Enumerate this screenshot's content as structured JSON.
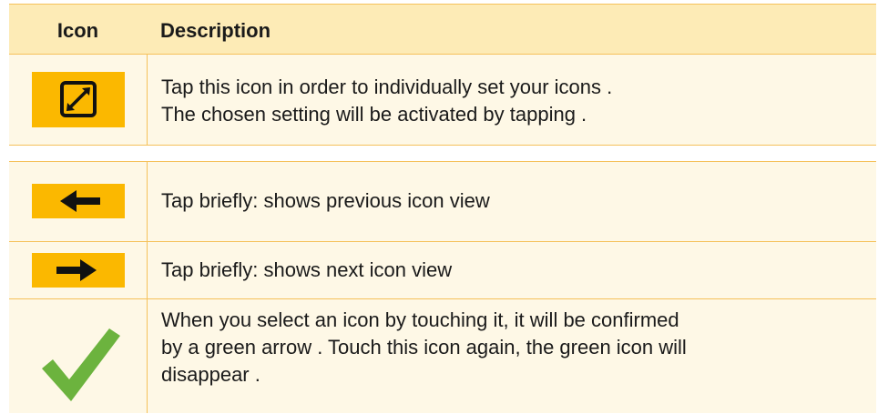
{
  "table1": {
    "header": {
      "icon_col": "Icon",
      "desc_col": "Description"
    },
    "rows": [
      {
        "icon": "resize-icon",
        "lines": [
          "Tap this icon in order to individually set your icons .",
          "The chosen setting will be activated by tapping ."
        ]
      }
    ]
  },
  "table2": {
    "rows": [
      {
        "icon": "arrow-left-icon",
        "text": "Tap briefly: shows previous icon view"
      },
      {
        "icon": "arrow-right-icon",
        "text": "Tap briefly: shows next icon view"
      },
      {
        "icon": "checkmark-icon",
        "lines": [
          "When you select an icon by touching it, it will be confirmed",
          "by a green arrow . Touch this icon again, the green icon will",
          "disappear ."
        ]
      }
    ]
  },
  "colors": {
    "accent_yellow": "#fbb800",
    "header_bg": "#fdebb6",
    "row_bg": "#fef8e6",
    "border": "#f5c15a",
    "check_green": "#6cb33e"
  }
}
